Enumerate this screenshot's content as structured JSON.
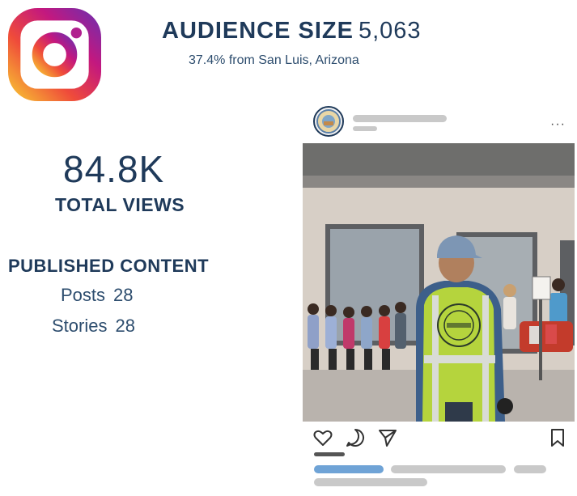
{
  "header": {
    "audience_label": "AUDIENCE SIZE",
    "audience_value": "5,063",
    "audience_sub": "37.4% from San Luis, Arizona"
  },
  "stats": {
    "views_value": "84.8K",
    "views_label": "TOTAL VIEWS",
    "published_label": "PUBLISHED CONTENT",
    "rows": [
      {
        "label": "Posts",
        "value": "28"
      },
      {
        "label": "Stories",
        "value": "28"
      }
    ]
  },
  "icons": {
    "logo": "instagram-logo-icon",
    "like": "heart-icon",
    "comment": "comment-bubble-icon",
    "share": "paper-plane-icon",
    "save": "bookmark-icon",
    "more": "ellipsis-icon"
  },
  "colors": {
    "text_primary": "#1f3a5a",
    "placeholder_gray": "#c9c9c9",
    "placeholder_blue": "#6fa3d6",
    "vest": "#b5d43d"
  },
  "post": {
    "more_label": "···"
  }
}
